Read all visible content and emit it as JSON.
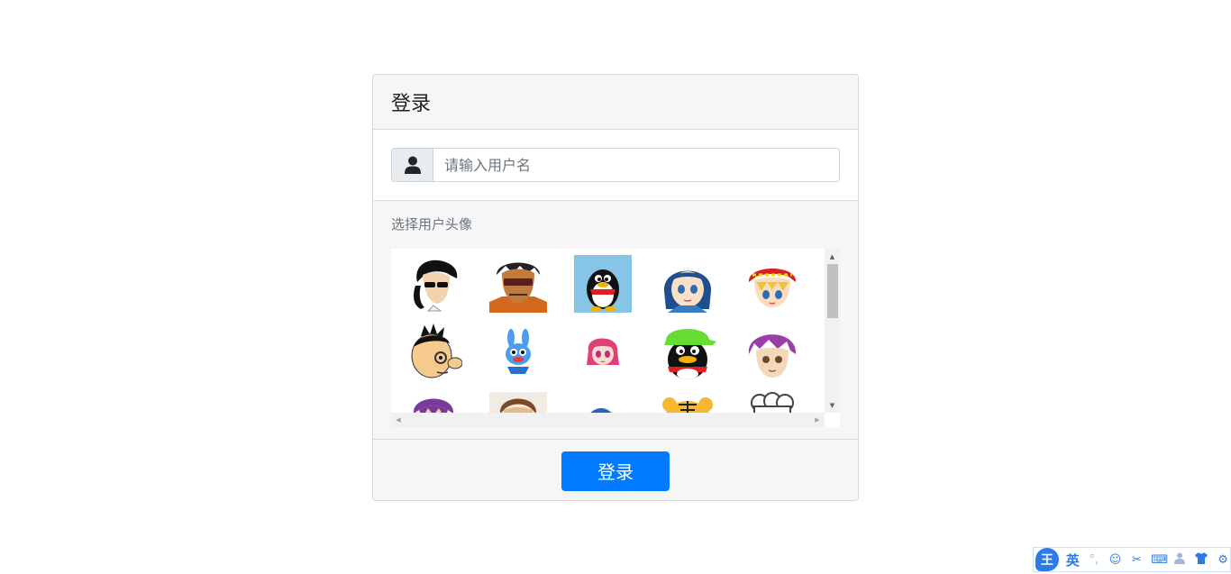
{
  "login": {
    "title": "登录",
    "username_placeholder": "请输入用户名",
    "avatar_label": "选择用户头像",
    "submit_label": "登录"
  },
  "avatars": [
    {
      "name": "avatar-man-sunglasses"
    },
    {
      "name": "avatar-man-shades-orange"
    },
    {
      "name": "avatar-qq-penguin"
    },
    {
      "name": "avatar-blue-hair-girl"
    },
    {
      "name": "avatar-red-bandana-boy"
    },
    {
      "name": "avatar-cartoon-boy-nose"
    },
    {
      "name": "avatar-blue-rabbit"
    },
    {
      "name": "avatar-pink-hair-girl"
    },
    {
      "name": "avatar-penguin-green-cap"
    },
    {
      "name": "avatar-purple-hair-boy"
    },
    {
      "name": "avatar-purple-hair-partial"
    },
    {
      "name": "avatar-brown-hair-partial"
    },
    {
      "name": "avatar-blue-partial"
    },
    {
      "name": "avatar-tiger-partial"
    },
    {
      "name": "avatar-chef-partial"
    }
  ],
  "ime": {
    "logo": "王",
    "lang": "英",
    "icons": [
      "punctuation-icon",
      "emoji-icon",
      "scissors-icon",
      "keyboard-icon",
      "user-icon",
      "shirt-icon",
      "gear-icon"
    ]
  },
  "colors": {
    "primary": "#007bff",
    "ime_blue": "#2b7ce9"
  }
}
